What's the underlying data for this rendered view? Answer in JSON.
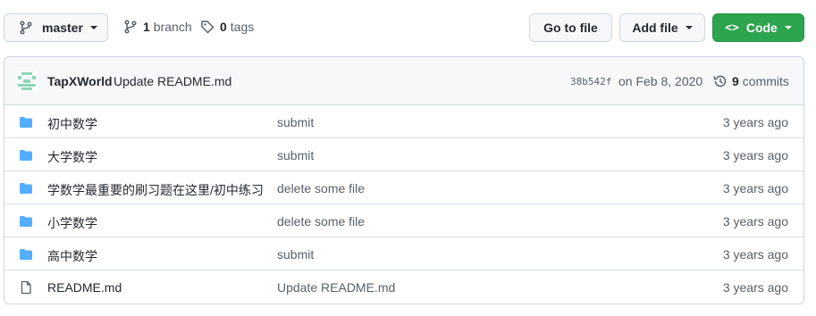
{
  "toolbar": {
    "branch_name": "master",
    "branch_count": "1",
    "branch_label": "branch",
    "tag_count": "0",
    "tag_label": "tags",
    "go_to_file": "Go to file",
    "add_file": "Add file",
    "code": "Code",
    "code_button_color": "#2da44e"
  },
  "latest_commit": {
    "author": "TapXWorld",
    "message": "Update README.md",
    "sha": "38b542f",
    "date": "on Feb 8, 2020",
    "commit_count": "9",
    "commit_label": "commits"
  },
  "colors": {
    "folder": "#54aeff",
    "file": "#57606a",
    "border": "#d0d7de"
  },
  "files": [
    {
      "type": "folder",
      "icon": "folder-icon",
      "name": "初中数学",
      "message": "submit",
      "age": "3 years ago"
    },
    {
      "type": "folder",
      "icon": "folder-icon",
      "name": "大学数学",
      "message": "submit",
      "age": "3 years ago"
    },
    {
      "type": "folder",
      "icon": "folder-icon",
      "name": "学数学最重要的刷习题在这里/初中练习",
      "message": "delete some file",
      "age": "3 years ago"
    },
    {
      "type": "folder",
      "icon": "folder-icon",
      "name": "小学数学",
      "message": "delete some file",
      "age": "3 years ago"
    },
    {
      "type": "folder",
      "icon": "folder-icon",
      "name": "高中数学",
      "message": "submit",
      "age": "3 years ago"
    },
    {
      "type": "file",
      "icon": "file-icon",
      "name": "README.md",
      "message": "Update README.md",
      "age": "3 years ago"
    }
  ]
}
